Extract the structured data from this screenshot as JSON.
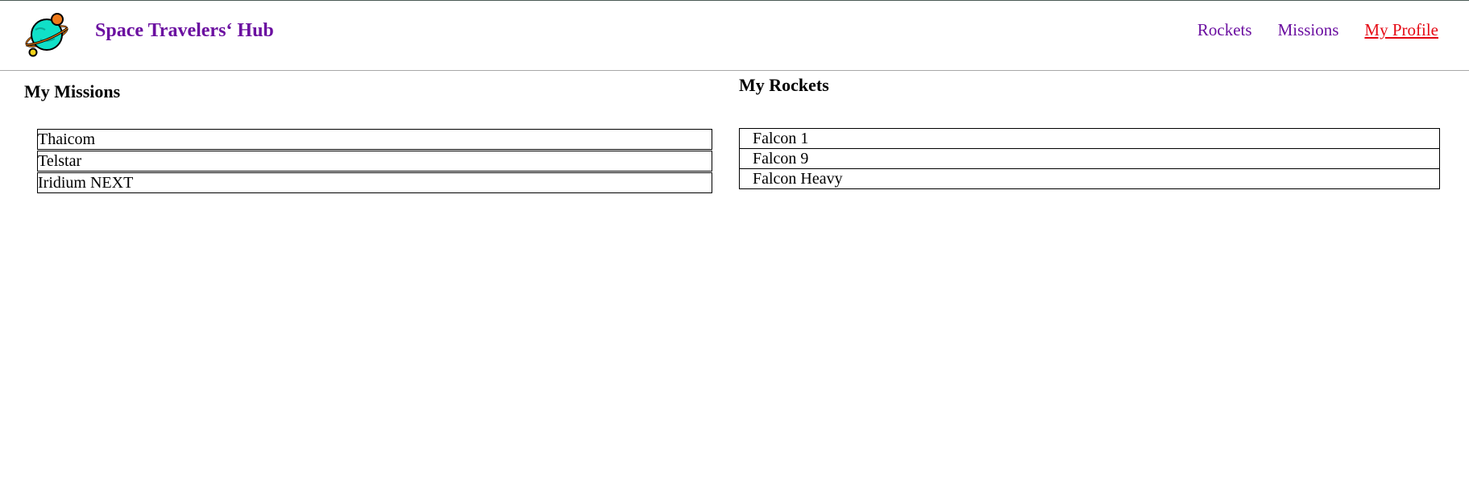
{
  "header": {
    "logo_icon": "planet-logo-icon",
    "brand": "Space Travelers‘ Hub",
    "nav": [
      {
        "label": "Rockets",
        "active": false
      },
      {
        "label": "Missions",
        "active": false
      },
      {
        "label": "My Profile",
        "active": true
      }
    ]
  },
  "missions": {
    "title": "My Missions",
    "items": [
      "Thaicom",
      "Telstar",
      "Iridium NEXT"
    ]
  },
  "rockets": {
    "title": "My Rockets",
    "items": [
      "Falcon 1",
      "Falcon 9",
      "Falcon Heavy"
    ]
  },
  "colors": {
    "brand": "#6b0fa0",
    "active_link": "#e50914",
    "planet": "#10e0c8",
    "moon": "#f07a1a"
  }
}
